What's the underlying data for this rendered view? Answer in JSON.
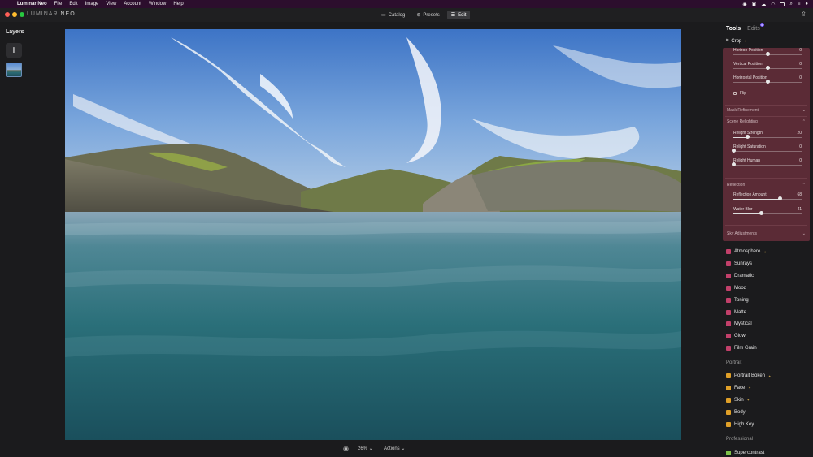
{
  "menubar": {
    "app_name": "Luminar Neo",
    "items": [
      "File",
      "Edit",
      "Image",
      "View",
      "Account",
      "Window",
      "Help"
    ]
  },
  "titlebar": {
    "logo_main": "LUMINAR",
    "logo_sub": "NEO",
    "modes": [
      {
        "label": "Catalog",
        "icon": "folder-icon",
        "active": false
      },
      {
        "label": "Presets",
        "icon": "presets-icon",
        "active": false
      },
      {
        "label": "Edit",
        "icon": "sliders-icon",
        "active": true
      }
    ]
  },
  "layers": {
    "title": "Layers",
    "add_label": "+"
  },
  "bottombar": {
    "zoom": "26%",
    "actions": "Actions"
  },
  "panel": {
    "tabs": [
      "Tools",
      "Edits"
    ],
    "edits_badge": "5",
    "crop_label": "Crop",
    "sliders": [
      {
        "label": "Horizon Position",
        "value": "0",
        "fraction": 0.5
      },
      {
        "label": "Vertical Position",
        "value": "0",
        "fraction": 0.5
      },
      {
        "label": "Horizontal Position",
        "value": "0",
        "fraction": 0.5
      },
      {
        "label": "Relight Strength",
        "value": "20",
        "fraction": 0.2
      },
      {
        "label": "Relight Saturation",
        "value": "0",
        "fraction": 0.0
      },
      {
        "label": "Relight Human",
        "value": "0",
        "fraction": 0.0
      },
      {
        "label": "Reflection Amount",
        "value": "68",
        "fraction": 0.68
      },
      {
        "label": "Water Blur",
        "value": "41",
        "fraction": 0.41
      }
    ],
    "flip_label": "Flip",
    "sections": [
      "Mask Refinement",
      "Scene Relighting",
      "Reflection",
      "Sky Adjustments"
    ],
    "tools": [
      {
        "label": "Atmosphere",
        "icon": "atmosphere-icon",
        "color": "#c2406a",
        "star": true
      },
      {
        "label": "Sunrays",
        "icon": "sunrays-icon",
        "color": "#c2406a",
        "star": false
      },
      {
        "label": "Dramatic",
        "icon": "dramatic-icon",
        "color": "#c2406a",
        "star": false
      },
      {
        "label": "Mood",
        "icon": "mood-icon",
        "color": "#c2406a",
        "star": false
      },
      {
        "label": "Toning",
        "icon": "toning-icon",
        "color": "#c2406a",
        "star": false
      },
      {
        "label": "Matte",
        "icon": "matte-icon",
        "color": "#c2406a",
        "star": false
      },
      {
        "label": "Mystical",
        "icon": "mystical-icon",
        "color": "#c2406a",
        "star": false
      },
      {
        "label": "Glow",
        "icon": "glow-icon",
        "color": "#c2406a",
        "star": false
      },
      {
        "label": "Film Grain",
        "icon": "film-grain-icon",
        "color": "#c2406a",
        "star": false
      }
    ],
    "portrait_heading": "Portrait",
    "portrait_tools": [
      {
        "label": "Portrait Bokeh",
        "icon": "portrait-bokeh-icon",
        "color": "#e0a028",
        "star": true
      },
      {
        "label": "Face",
        "icon": "face-icon",
        "color": "#e0a028",
        "star": true
      },
      {
        "label": "Skin",
        "icon": "skin-icon",
        "color": "#e0a028",
        "star": true
      },
      {
        "label": "Body",
        "icon": "body-icon",
        "color": "#e0a028",
        "star": true
      },
      {
        "label": "High Key",
        "icon": "high-key-icon",
        "color": "#e0a028",
        "star": false
      }
    ],
    "professional_heading": "Professional",
    "professional_tools": [
      {
        "label": "Supercontrast",
        "icon": "supercontrast-icon",
        "color": "#7fc24a",
        "star": false
      }
    ]
  }
}
